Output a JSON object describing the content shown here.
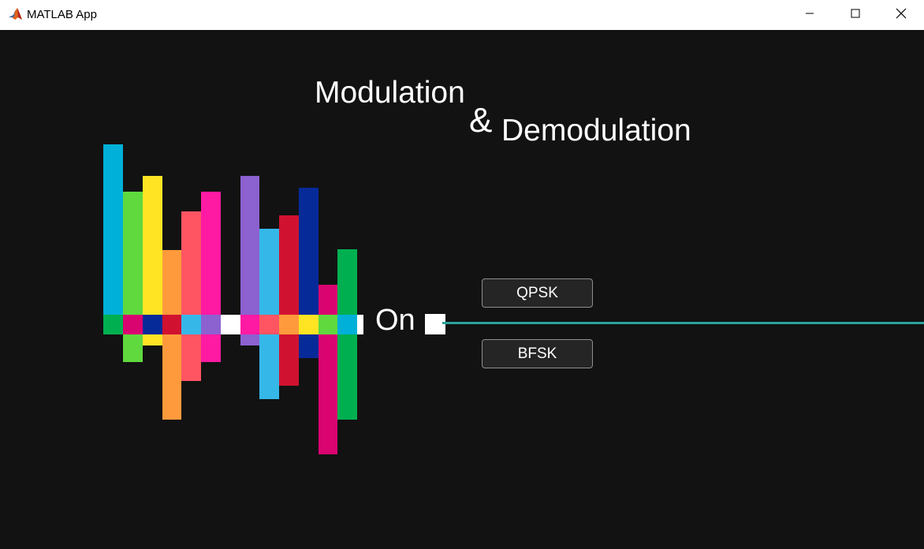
{
  "window": {
    "title": "MATLAB App",
    "icon": "matlab-icon",
    "controls": [
      "minimize-icon",
      "maximize-icon",
      "close-icon"
    ]
  },
  "heading": {
    "word1": "Modulation",
    "ampersand": "&",
    "word2": "Demodulation"
  },
  "graphic": {
    "label": "On",
    "colors": {
      "line": "#2aa39a"
    }
  },
  "buttons": {
    "qpsk": "QPSK",
    "bfsk": "BFSK"
  }
}
